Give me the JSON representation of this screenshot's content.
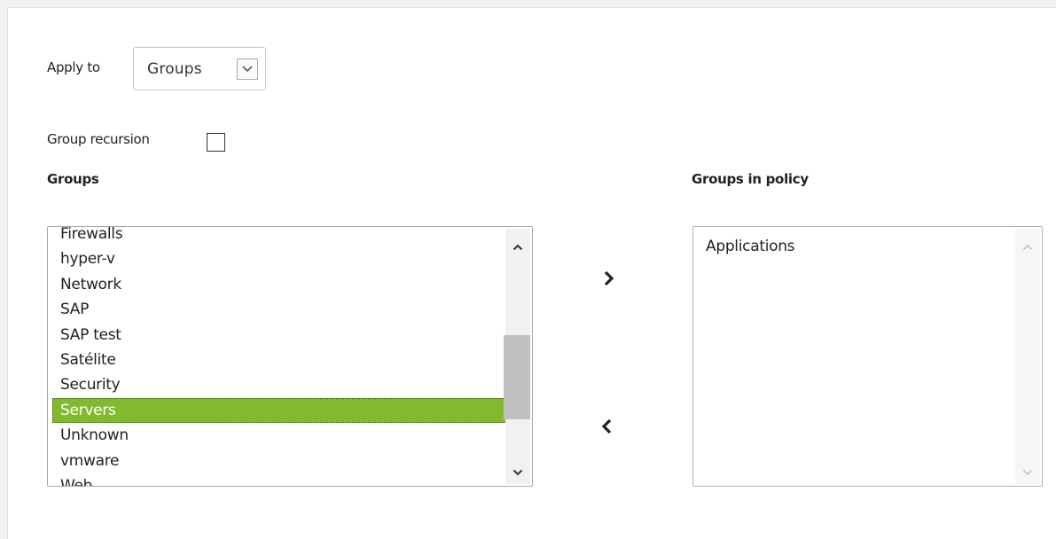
{
  "apply_to": {
    "label": "Apply to",
    "selected": "Groups"
  },
  "group_recursion": {
    "label": "Group recursion",
    "checked": false
  },
  "groups": {
    "heading": "Groups",
    "items": [
      "Firewalls",
      "hyper-v",
      "Network",
      "SAP",
      "SAP test",
      "Satélite",
      "Security",
      "Servers",
      "Unknown",
      "vmware",
      "Web"
    ],
    "selected": "Servers"
  },
  "groups_in_policy": {
    "heading": "Groups in policy",
    "items": [
      "Applications"
    ]
  },
  "icons": {
    "add": "chevron-right-icon",
    "remove": "chevron-left-icon",
    "dropdown": "chevron-down-icon"
  },
  "colors": {
    "selection": "#82b92e"
  }
}
